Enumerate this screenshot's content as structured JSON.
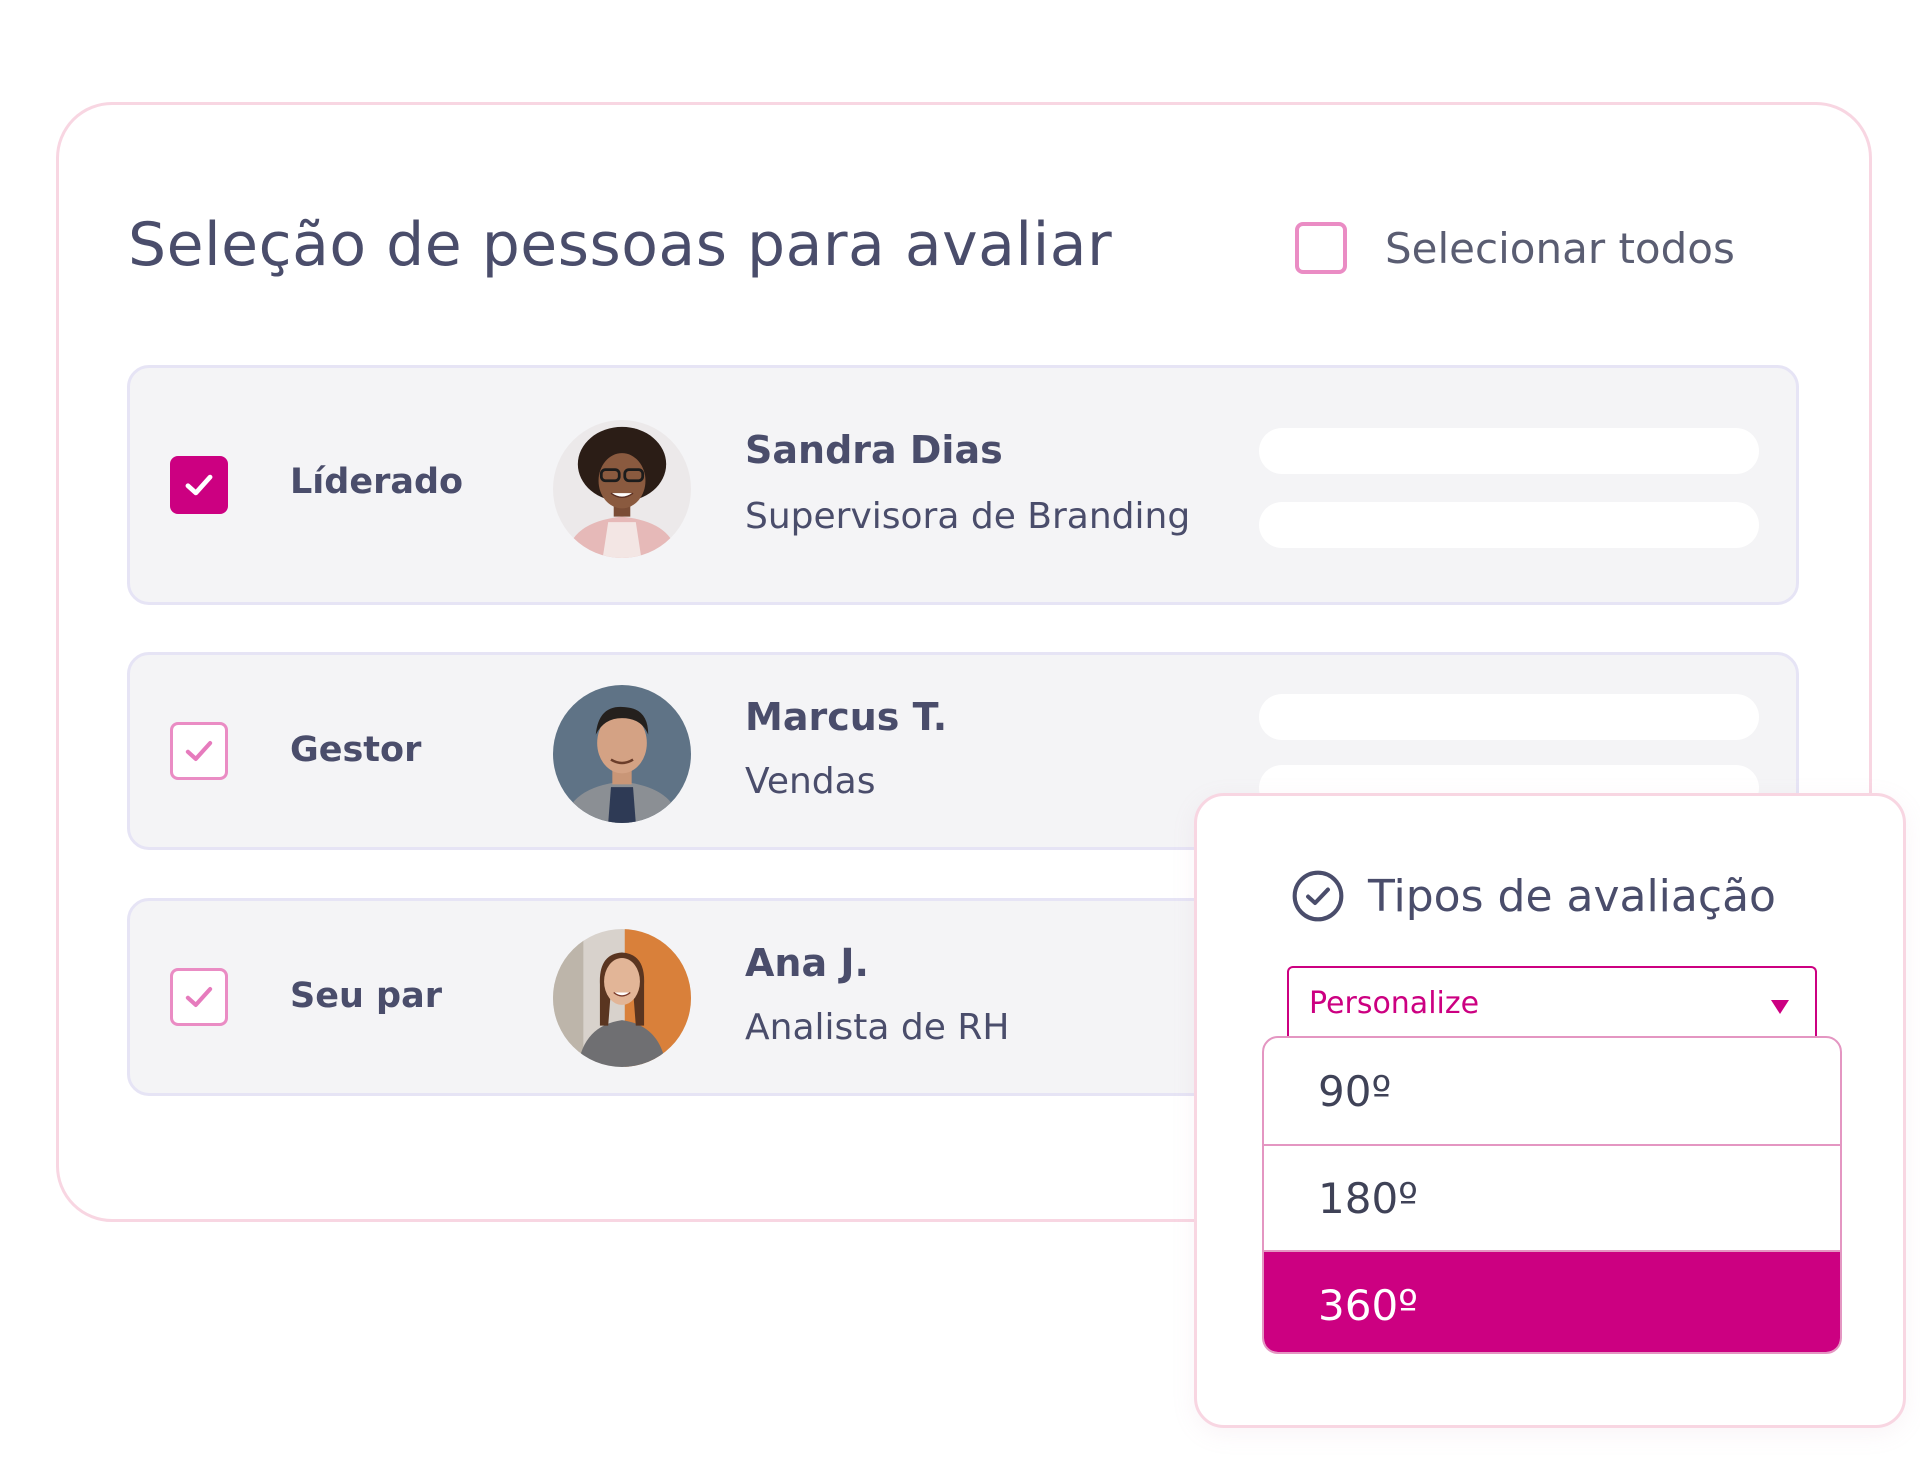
{
  "header": {
    "title": "Seleção de pessoas para avaliar",
    "select_all_label": "Selecionar todos"
  },
  "rows": [
    {
      "role": "Líderado",
      "name": "Sandra Dias",
      "subtitle": "Supervisora de Branding",
      "checked": true,
      "checkbox_style": "filled"
    },
    {
      "role": "Gestor",
      "name": "Marcus T.",
      "subtitle": "Vendas",
      "checked": true,
      "checkbox_style": "outline"
    },
    {
      "role": "Seu par",
      "name": "Ana J.",
      "subtitle": "Analista de RH",
      "checked": true,
      "checkbox_style": "outline"
    }
  ],
  "evaluation_panel": {
    "title": "Tipos de avaliação",
    "title_icon": "check-circle-icon",
    "select_value": "Personalize",
    "options": [
      "90º",
      "180º",
      "360º"
    ],
    "selected_option": "360º"
  },
  "colors": {
    "accent": "#cc0081",
    "accent_light": "#ea8cc4",
    "text": "#4a4d6b",
    "row_bg": "#f4f4f6",
    "card_border": "#f8d6e2"
  }
}
